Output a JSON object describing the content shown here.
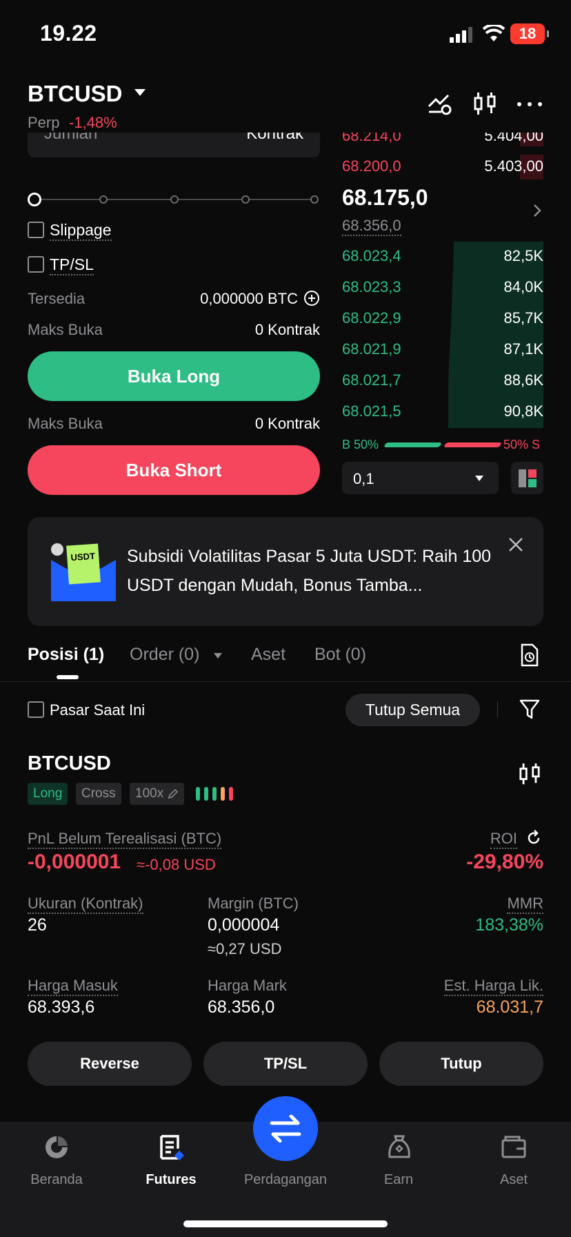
{
  "status_bar": {
    "time": "19.22",
    "battery": "18"
  },
  "header": {
    "pair": "BTCUSD",
    "perp": "Perp",
    "change": "-1,48%"
  },
  "form": {
    "amount_placeholder": "Jumlah",
    "amount_unit": "Kontrak",
    "slippage_label": "Slippage",
    "tpsl_label": "TP/SL",
    "available_label": "Tersedia",
    "available_value": "0,000000 BTC",
    "max_open_label": "Maks Buka",
    "max_open_long": "0 Kontrak",
    "max_open_short": "0 Kontrak",
    "buy_long": "Buka Long",
    "sell_short": "Buka Short"
  },
  "orderbook": {
    "asks": [
      {
        "price": "68.214,0",
        "qty": "5.404,00"
      },
      {
        "price": "68.200,0",
        "qty": "5.403,00"
      }
    ],
    "last_price": "68.175,0",
    "mark_price": "68.356,0",
    "bids": [
      {
        "price": "68.023,4",
        "qty": "82,5K"
      },
      {
        "price": "68.023,3",
        "qty": "84,0K"
      },
      {
        "price": "68.022,9",
        "qty": "85,7K"
      },
      {
        "price": "68.021,9",
        "qty": "87,1K"
      },
      {
        "price": "68.021,7",
        "qty": "88,6K"
      },
      {
        "price": "68.021,5",
        "qty": "90,8K"
      }
    ],
    "buy_pct_label": "B 50%",
    "sell_pct_label": "50% S",
    "buy_ratio": 0.5,
    "precision": "0,1"
  },
  "banner": {
    "badge": "USDT",
    "text": "Subsidi Volatilitas Pasar 5 Juta USDT: Raih 100 USDT dengan Mudah, Bonus Tamba..."
  },
  "tabs": [
    "Posisi (1)",
    "Order (0)",
    "Aset",
    "Bot (0)"
  ],
  "filter": {
    "current_market": "Pasar Saat Ini",
    "close_all": "Tutup Semua"
  },
  "position": {
    "symbol": "BTCUSD",
    "side": "Long",
    "margin_mode": "Cross",
    "leverage": "100x",
    "pnl_label": "PnL Belum Terealisasi (BTC)",
    "pnl_value": "-0,000001",
    "pnl_usd": "≈-0,08 USD",
    "roi_label": "ROI",
    "roi_value": "-29,80%",
    "size_label": "Ukuran (Kontrak)",
    "size_value": "26",
    "margin_label": "Margin (BTC)",
    "margin_value": "0,000004",
    "margin_usd": "≈0,27 USD",
    "mmr_label": "MMR",
    "mmr_value": "183,38%",
    "entry_label": "Harga Masuk",
    "entry_value": "68.393,6",
    "mark_label": "Harga Mark",
    "mark_value": "68.356,0",
    "liq_label": "Est. Harga Lik.",
    "liq_value": "68.031,7",
    "reverse": "Reverse",
    "tpsl": "TP/SL",
    "close": "Tutup"
  },
  "nav": {
    "home": "Beranda",
    "futures": "Futures",
    "trade": "Perdagangan",
    "earn": "Earn",
    "assets": "Aset"
  },
  "colors": {
    "green": "#2ebd85",
    "red": "#f6465d",
    "accent_blue": "#1f5fff"
  }
}
